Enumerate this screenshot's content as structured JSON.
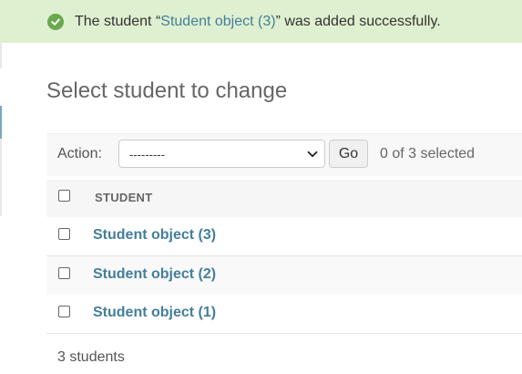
{
  "message": {
    "prefix": "The student “",
    "link_text": "Student object (3)",
    "suffix": "” was added successfully.",
    "icon": "check-circle-icon",
    "bg_color": "#dff0d0",
    "icon_color": "#6aa84f"
  },
  "page": {
    "title": "Select student to change"
  },
  "actions": {
    "label": "Action:",
    "selected_value": "---------",
    "go_label": "Go",
    "selected_count_text": "0 of 3 selected"
  },
  "table": {
    "column_header": "STUDENT",
    "rows": [
      {
        "label": "Student object (3)"
      },
      {
        "label": "Student object (2)"
      },
      {
        "label": "Student object (1)"
      }
    ]
  },
  "footer": {
    "count_text": "3 students"
  },
  "colors": {
    "link": "#447e9b",
    "header_bg": "#f6f6f6"
  }
}
